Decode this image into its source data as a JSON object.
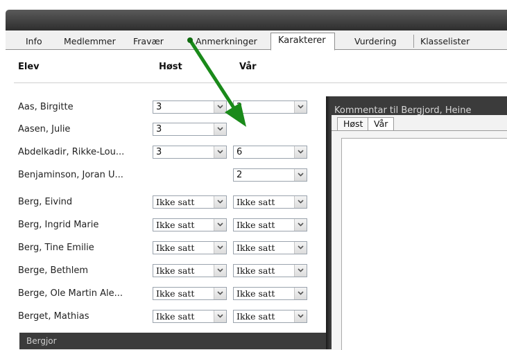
{
  "tabs": [
    {
      "label": "Info"
    },
    {
      "label": "Medlemmer"
    },
    {
      "label": "Fravær"
    },
    {
      "label": "Anmerkninger"
    },
    {
      "label": "Karakterer"
    },
    {
      "label": "Vurdering"
    },
    {
      "label": "Klasselister"
    }
  ],
  "table": {
    "headers": {
      "student": "Elev",
      "autumn": "Høst",
      "spring": "Vår"
    },
    "rows": [
      {
        "name": "Aas, Birgitte",
        "autumn": "3",
        "spring": "2"
      },
      {
        "name": "Aasen, Julie",
        "autumn": "3",
        "spring": ""
      },
      {
        "name": "Abdelkadir, Rikke-Lou...",
        "autumn": "3",
        "spring": "6"
      },
      {
        "name": "Benjaminson, Joran U...",
        "autumn": "",
        "spring": "2"
      },
      {
        "name": "Berg, Eivind",
        "autumn": "Ikke satt",
        "spring": "Ikke satt"
      },
      {
        "name": "Berg, Ingrid Marie",
        "autumn": "Ikke satt",
        "spring": "Ikke satt"
      },
      {
        "name": "Berg, Tine Emilie",
        "autumn": "Ikke satt",
        "spring": "Ikke satt"
      },
      {
        "name": "Berge, Bethlem",
        "autumn": "Ikke satt",
        "spring": "Ikke satt"
      },
      {
        "name": "Berge, Ole Martin Ale...",
        "autumn": "Ikke satt",
        "spring": "Ikke satt"
      },
      {
        "name": "Berget, Mathias",
        "autumn": "Ikke satt",
        "spring": "Ikke satt"
      },
      {
        "name": "Bergjor"
      }
    ]
  },
  "comment_panel": {
    "title": "Kommentar til Bergjord, Heine",
    "tabs": [
      {
        "label": "Høst"
      },
      {
        "label": "Vår"
      }
    ]
  },
  "colors": {
    "arrow": "#1a8a1a",
    "titlebar": "#3a3a3a",
    "panel": "#3b3b3b"
  },
  "icons": {
    "dropdown": "chevron-down-icon",
    "annotation": "arrow-annotation"
  }
}
